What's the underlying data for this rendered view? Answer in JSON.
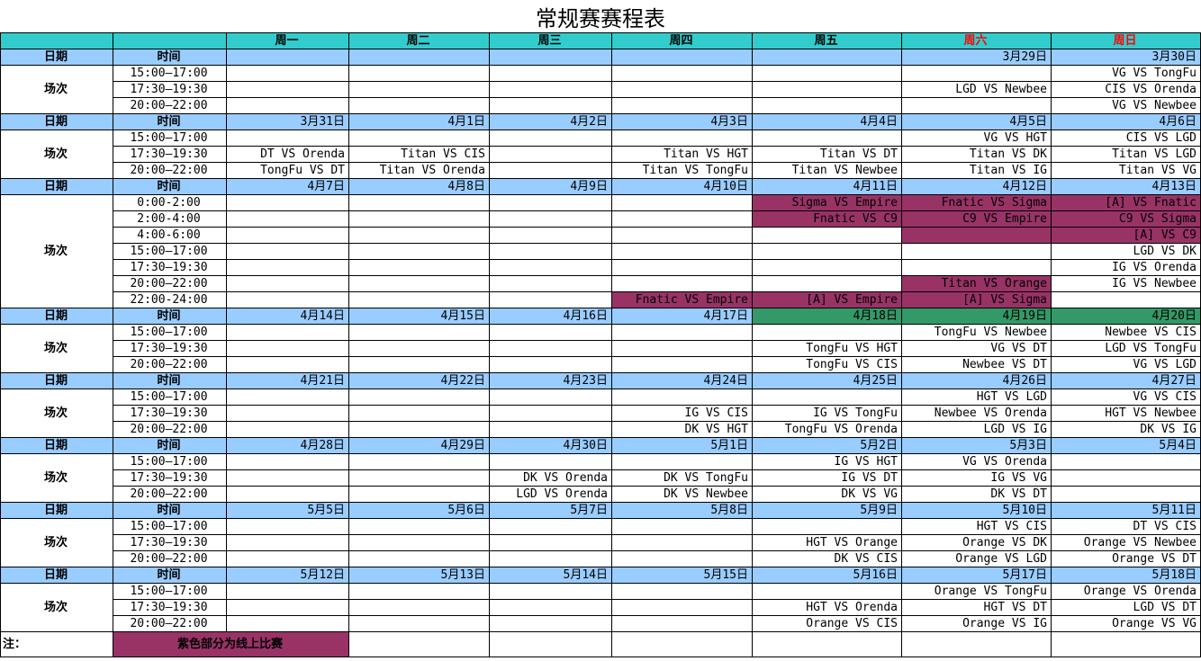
{
  "title": "常规赛赛程表",
  "colors": {
    "header_bg": "#33cccc",
    "date_row_bg": "#99ccff",
    "online_bg": "#993366",
    "green_bg": "#339966",
    "weekend_red": "#ff0000"
  },
  "header": {
    "days": [
      "周一",
      "周二",
      "周三",
      "周四",
      "周五",
      "周六",
      "周日"
    ],
    "date_label": "日期",
    "time_label": "时间",
    "slot_label": "场次"
  },
  "weeks": [
    {
      "dates": [
        "",
        "",
        "",
        "",
        "",
        "3月29日",
        "3月30日"
      ],
      "slots": [
        {
          "time": "15:00—17:00",
          "games": [
            "",
            "",
            "",
            "",
            "",
            "",
            "VG VS TongFu"
          ]
        },
        {
          "time": "17:30—19:30",
          "games": [
            "",
            "",
            "",
            "",
            "",
            "LGD VS Newbee",
            "CIS VS Orenda"
          ]
        },
        {
          "time": "20:00—22:00",
          "games": [
            "",
            "",
            "",
            "",
            "",
            "",
            "VG VS Newbee"
          ]
        }
      ]
    },
    {
      "dates": [
        "3月31日",
        "4月1日",
        "4月2日",
        "4月3日",
        "4月4日",
        "4月5日",
        "4月6日"
      ],
      "slots": [
        {
          "time": "15:00—17:00",
          "games": [
            "",
            "",
            "",
            "",
            "",
            "VG VS HGT",
            "CIS VS LGD"
          ]
        },
        {
          "time": "17:30—19:30",
          "games": [
            "DT VS Orenda",
            "Titan VS CIS",
            "",
            "Titan VS HGT",
            "Titan VS DT",
            "Titan VS DK",
            "Titan VS LGD"
          ]
        },
        {
          "time": "20:00—22:00",
          "games": [
            "TongFu VS DT",
            "Titan VS Orenda",
            "",
            "Titan VS TongFu",
            "Titan VS Newbee",
            "Titan VS IG",
            "Titan VS VG"
          ]
        }
      ]
    },
    {
      "dates": [
        "4月7日",
        "4月8日",
        "4月9日",
        "4月10日",
        "4月11日",
        "4月12日",
        "4月13日"
      ],
      "slots": [
        {
          "time": "0:00-2:00",
          "games": [
            "",
            "",
            "",
            "",
            "Sigma  VS  Empire",
            "Fnatic VS Sigma",
            "[A] VS Fnatic"
          ]
        },
        {
          "time": "2:00-4:00",
          "games": [
            "",
            "",
            "",
            "",
            "Fnatic VS C9",
            "C9 VS Empire",
            "C9 VS Sigma"
          ]
        },
        {
          "time": "4:00-6:00",
          "games": [
            "",
            "",
            "",
            "",
            "",
            "",
            "[A]  VS  C9"
          ]
        },
        {
          "time": "15:00—17:00",
          "games": [
            "",
            "",
            "",
            "",
            "",
            "",
            "LGD VS DK"
          ]
        },
        {
          "time": "17:30—19:30",
          "games": [
            "",
            "",
            "",
            "",
            "",
            "",
            "IG VS Orenda"
          ]
        },
        {
          "time": "20:00—22:00",
          "games": [
            "",
            "",
            "",
            "",
            "",
            "Titan VS Orange",
            "IG VS Newbee"
          ]
        },
        {
          "time": "22:00-24:00",
          "games": [
            "",
            "",
            "",
            "Fnatic VS Empire",
            "[A] VS Empire",
            "[A] VS Sigma",
            ""
          ]
        }
      ]
    },
    {
      "dates": [
        "4月14日",
        "4月15日",
        "4月16日",
        "4月17日",
        "4月18日",
        "4月19日",
        "4月20日"
      ],
      "slots": [
        {
          "time": "15:00—17:00",
          "games": [
            "",
            "",
            "",
            "",
            "",
            "TongFu VS Newbee",
            "Newbee VS CIS"
          ]
        },
        {
          "time": "17:30—19:30",
          "games": [
            "",
            "",
            "",
            "",
            "TongFu VS HGT",
            "VG VS DT",
            "LGD VS TongFu"
          ]
        },
        {
          "time": "20:00—22:00",
          "games": [
            "",
            "",
            "",
            "",
            "TongFu VS CIS",
            "Newbee VS DT",
            "VG VS LGD"
          ]
        }
      ]
    },
    {
      "dates": [
        "4月21日",
        "4月22日",
        "4月23日",
        "4月24日",
        "4月25日",
        "4月26日",
        "4月27日"
      ],
      "slots": [
        {
          "time": "15:00—17:00",
          "games": [
            "",
            "",
            "",
            "",
            "",
            "HGT VS LGD",
            "VG VS CIS"
          ]
        },
        {
          "time": "17:30—19:30",
          "games": [
            "",
            "",
            "",
            "IG VS CIS",
            "IG VS TongFu",
            "Newbee VS Orenda",
            "HGT VS Newbee"
          ]
        },
        {
          "time": "20:00—22:00",
          "games": [
            "",
            "",
            "",
            "DK VS HGT",
            "TongFu VS Orenda",
            "LGD VS IG",
            "DK VS IG"
          ]
        }
      ]
    },
    {
      "dates": [
        "4月28日",
        "4月29日",
        "4月30日",
        "5月1日",
        "5月2日",
        "5月3日",
        "5月4日"
      ],
      "slots": [
        {
          "time": "15:00—17:00",
          "games": [
            "",
            "",
            "",
            "",
            "IG VS HGT",
            "VG VS Orenda",
            ""
          ]
        },
        {
          "time": "17:30—19:30",
          "games": [
            "",
            "",
            "DK VS Orenda",
            "DK VS TongFu",
            "IG VS DT",
            "IG VS VG",
            ""
          ]
        },
        {
          "time": "20:00—22:00",
          "games": [
            "",
            "",
            "LGD VS Orenda",
            "DK VS Newbee",
            "DK VS VG",
            "DK VS DT",
            ""
          ]
        }
      ]
    },
    {
      "dates": [
        "5月5日",
        "5月6日",
        "5月7日",
        "5月8日",
        "5月9日",
        "5月10日",
        "5月11日"
      ],
      "slots": [
        {
          "time": "15:00—17:00",
          "games": [
            "",
            "",
            "",
            "",
            "",
            "HGT VS CIS",
            "DT VS CIS"
          ]
        },
        {
          "time": "17:30—19:30",
          "games": [
            "",
            "",
            "",
            "",
            "HGT VS Orange",
            "Orange VS DK",
            "Orange VS Newbee"
          ]
        },
        {
          "time": "20:00—22:00",
          "games": [
            "",
            "",
            "",
            "",
            "DK VS CIS",
            "Orange VS LGD",
            "Orange VS DT"
          ]
        }
      ]
    },
    {
      "dates": [
        "5月12日",
        "5月13日",
        "5月14日",
        "5月15日",
        "5月16日",
        "5月17日",
        "5月18日"
      ],
      "slots": [
        {
          "time": "15:00—17:00",
          "games": [
            "",
            "",
            "",
            "",
            "",
            "Orange VS TongFu",
            "Orange VS Orenda"
          ]
        },
        {
          "time": "17:30—19:30",
          "games": [
            "",
            "",
            "",
            "",
            "HGT VS Orenda",
            "HGT VS DT",
            "LGD VS DT"
          ]
        },
        {
          "time": "20:00—22:00",
          "games": [
            "",
            "",
            "",
            "",
            "Orange VS CIS",
            "Orange VS IG",
            "Orange VS VG"
          ]
        }
      ]
    }
  ],
  "note": {
    "label": "注：",
    "legend": "紫色部分为线上比赛"
  }
}
